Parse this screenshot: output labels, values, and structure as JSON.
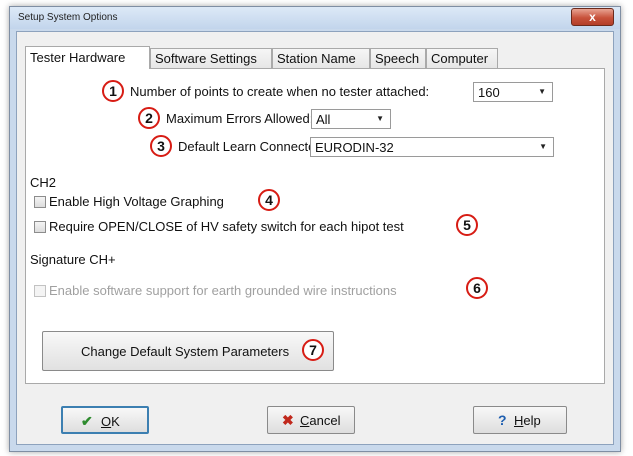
{
  "window": {
    "title": "Setup System Options",
    "close_glyph": "x"
  },
  "tabs": [
    "Tester Hardware",
    "Software Settings",
    "Station Name",
    "Speech",
    "Computer"
  ],
  "fields": {
    "points": {
      "badge": "1",
      "label": "Number of points to create when no tester attached:",
      "value": "160"
    },
    "max_errors": {
      "badge": "2",
      "label": "Maximum Errors Allowed:",
      "value": "All"
    },
    "learn_connector": {
      "badge": "3",
      "label": "Default Learn Connector:",
      "value": "EURODIN-32"
    }
  },
  "sections": {
    "ch2": {
      "heading": "CH2",
      "high_voltage": {
        "badge": "4",
        "label": "Enable High Voltage Graphing",
        "checked": false
      },
      "hv_switch": {
        "badge": "5",
        "label": "Require OPEN/CLOSE of HV safety switch for each hipot test",
        "checked": false
      }
    },
    "signature": {
      "heading": "Signature CH+",
      "earth_ground": {
        "badge": "6",
        "label": "Enable software support for earth grounded wire instructions",
        "checked": false,
        "disabled": true
      }
    }
  },
  "change_params": {
    "badge": "7",
    "label": "Change Default System Parameters"
  },
  "buttons": {
    "ok": {
      "icon": "checkmark-icon",
      "glyph": "✔",
      "mnemonic": "O",
      "rest": "K",
      "icon_color": "#2e8b2e"
    },
    "cancel": {
      "icon": "x-icon",
      "glyph": "✖",
      "mnemonic": "C",
      "rest": "ancel",
      "icon_color": "#c0281c"
    },
    "help": {
      "icon": "question-icon",
      "glyph": "?",
      "mnemonic": "H",
      "rest": "elp",
      "icon_color": "#1f5fb0"
    }
  },
  "colors": {
    "badge_ring": "#d71c14",
    "tab_border": "#a9a9a9"
  }
}
